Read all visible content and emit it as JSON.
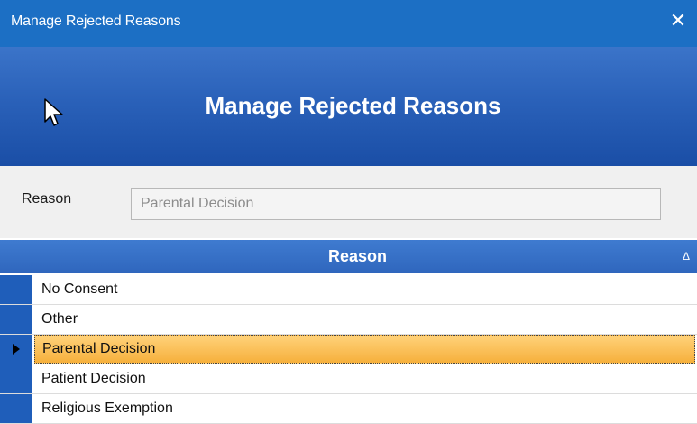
{
  "window": {
    "title": "Manage Rejected Reasons",
    "close_glyph": "✕"
  },
  "banner": {
    "heading": "Manage Rejected Reasons",
    "cursor_icon": "mouse-pointer-icon"
  },
  "form": {
    "reason_label": "Reason",
    "reason_value": "Parental Decision"
  },
  "grid": {
    "column_header": "Reason",
    "sort_indicator": "Δ",
    "rows": [
      {
        "reason": "No Consent",
        "selected": false
      },
      {
        "reason": "Other",
        "selected": false
      },
      {
        "reason": "Parental Decision",
        "selected": true
      },
      {
        "reason": "Patient Decision",
        "selected": false
      },
      {
        "reason": "Religious Exemption",
        "selected": false
      }
    ]
  },
  "colors": {
    "titlebar": "#1c6fc4",
    "banner": "#2a61b9",
    "row_selector": "#1f5eba",
    "selection": "#f6b03c"
  }
}
